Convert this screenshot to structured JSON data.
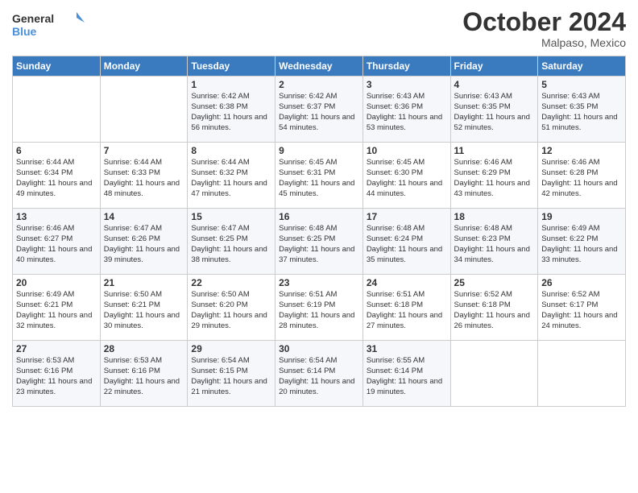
{
  "logo": {
    "line1": "General",
    "line2": "Blue"
  },
  "title": "October 2024",
  "location": "Malpaso, Mexico",
  "weekdays": [
    "Sunday",
    "Monday",
    "Tuesday",
    "Wednesday",
    "Thursday",
    "Friday",
    "Saturday"
  ],
  "weeks": [
    [
      {
        "day": "",
        "info": ""
      },
      {
        "day": "",
        "info": ""
      },
      {
        "day": "1",
        "info": "Sunrise: 6:42 AM\nSunset: 6:38 PM\nDaylight: 11 hours and 56 minutes."
      },
      {
        "day": "2",
        "info": "Sunrise: 6:42 AM\nSunset: 6:37 PM\nDaylight: 11 hours and 54 minutes."
      },
      {
        "day": "3",
        "info": "Sunrise: 6:43 AM\nSunset: 6:36 PM\nDaylight: 11 hours and 53 minutes."
      },
      {
        "day": "4",
        "info": "Sunrise: 6:43 AM\nSunset: 6:35 PM\nDaylight: 11 hours and 52 minutes."
      },
      {
        "day": "5",
        "info": "Sunrise: 6:43 AM\nSunset: 6:35 PM\nDaylight: 11 hours and 51 minutes."
      }
    ],
    [
      {
        "day": "6",
        "info": "Sunrise: 6:44 AM\nSunset: 6:34 PM\nDaylight: 11 hours and 49 minutes."
      },
      {
        "day": "7",
        "info": "Sunrise: 6:44 AM\nSunset: 6:33 PM\nDaylight: 11 hours and 48 minutes."
      },
      {
        "day": "8",
        "info": "Sunrise: 6:44 AM\nSunset: 6:32 PM\nDaylight: 11 hours and 47 minutes."
      },
      {
        "day": "9",
        "info": "Sunrise: 6:45 AM\nSunset: 6:31 PM\nDaylight: 11 hours and 45 minutes."
      },
      {
        "day": "10",
        "info": "Sunrise: 6:45 AM\nSunset: 6:30 PM\nDaylight: 11 hours and 44 minutes."
      },
      {
        "day": "11",
        "info": "Sunrise: 6:46 AM\nSunset: 6:29 PM\nDaylight: 11 hours and 43 minutes."
      },
      {
        "day": "12",
        "info": "Sunrise: 6:46 AM\nSunset: 6:28 PM\nDaylight: 11 hours and 42 minutes."
      }
    ],
    [
      {
        "day": "13",
        "info": "Sunrise: 6:46 AM\nSunset: 6:27 PM\nDaylight: 11 hours and 40 minutes."
      },
      {
        "day": "14",
        "info": "Sunrise: 6:47 AM\nSunset: 6:26 PM\nDaylight: 11 hours and 39 minutes."
      },
      {
        "day": "15",
        "info": "Sunrise: 6:47 AM\nSunset: 6:25 PM\nDaylight: 11 hours and 38 minutes."
      },
      {
        "day": "16",
        "info": "Sunrise: 6:48 AM\nSunset: 6:25 PM\nDaylight: 11 hours and 37 minutes."
      },
      {
        "day": "17",
        "info": "Sunrise: 6:48 AM\nSunset: 6:24 PM\nDaylight: 11 hours and 35 minutes."
      },
      {
        "day": "18",
        "info": "Sunrise: 6:48 AM\nSunset: 6:23 PM\nDaylight: 11 hours and 34 minutes."
      },
      {
        "day": "19",
        "info": "Sunrise: 6:49 AM\nSunset: 6:22 PM\nDaylight: 11 hours and 33 minutes."
      }
    ],
    [
      {
        "day": "20",
        "info": "Sunrise: 6:49 AM\nSunset: 6:21 PM\nDaylight: 11 hours and 32 minutes."
      },
      {
        "day": "21",
        "info": "Sunrise: 6:50 AM\nSunset: 6:21 PM\nDaylight: 11 hours and 30 minutes."
      },
      {
        "day": "22",
        "info": "Sunrise: 6:50 AM\nSunset: 6:20 PM\nDaylight: 11 hours and 29 minutes."
      },
      {
        "day": "23",
        "info": "Sunrise: 6:51 AM\nSunset: 6:19 PM\nDaylight: 11 hours and 28 minutes."
      },
      {
        "day": "24",
        "info": "Sunrise: 6:51 AM\nSunset: 6:18 PM\nDaylight: 11 hours and 27 minutes."
      },
      {
        "day": "25",
        "info": "Sunrise: 6:52 AM\nSunset: 6:18 PM\nDaylight: 11 hours and 26 minutes."
      },
      {
        "day": "26",
        "info": "Sunrise: 6:52 AM\nSunset: 6:17 PM\nDaylight: 11 hours and 24 minutes."
      }
    ],
    [
      {
        "day": "27",
        "info": "Sunrise: 6:53 AM\nSunset: 6:16 PM\nDaylight: 11 hours and 23 minutes."
      },
      {
        "day": "28",
        "info": "Sunrise: 6:53 AM\nSunset: 6:16 PM\nDaylight: 11 hours and 22 minutes."
      },
      {
        "day": "29",
        "info": "Sunrise: 6:54 AM\nSunset: 6:15 PM\nDaylight: 11 hours and 21 minutes."
      },
      {
        "day": "30",
        "info": "Sunrise: 6:54 AM\nSunset: 6:14 PM\nDaylight: 11 hours and 20 minutes."
      },
      {
        "day": "31",
        "info": "Sunrise: 6:55 AM\nSunset: 6:14 PM\nDaylight: 11 hours and 19 minutes."
      },
      {
        "day": "",
        "info": ""
      },
      {
        "day": "",
        "info": ""
      }
    ]
  ]
}
